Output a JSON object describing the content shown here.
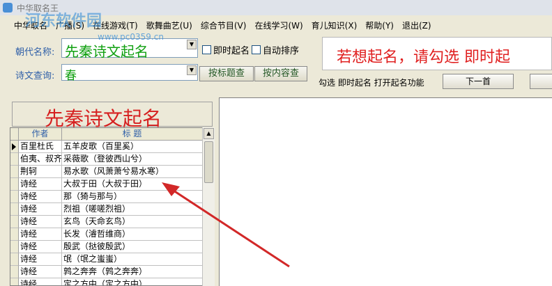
{
  "window": {
    "title": "中华取名王"
  },
  "watermark": {
    "text": "河东软件园",
    "url": "www.pc0359.cn"
  },
  "menu": {
    "items": [
      {
        "label": "中华取名"
      },
      {
        "label": "广播(S)"
      },
      {
        "label": "在线游戏(T)"
      },
      {
        "label": "歌舞曲艺(U)"
      },
      {
        "label": "综合节目(V)"
      },
      {
        "label": "在线学习(W)"
      },
      {
        "label": "育儿知识(X)"
      },
      {
        "label": "帮助(Y)"
      },
      {
        "label": "退出(Z)"
      }
    ]
  },
  "form": {
    "dynasty_label": "朝代名称:",
    "dynasty_value": "先秦诗文起名",
    "instant_checkbox_label": "即时起名",
    "autosort_checkbox_label": "自动排序",
    "query_label": "诗文查询:",
    "query_value": "春",
    "search_title_button": "按标题查",
    "search_content_button": "按内容查"
  },
  "banner": {
    "text": "若想起名，请勾选 即时起"
  },
  "hint": {
    "text": "勾选 即时起名 打开起名功能"
  },
  "next_button": {
    "label": "下一首"
  },
  "panel_title": {
    "text": "先秦诗文起名"
  },
  "table": {
    "columns": [
      "作者",
      "标 题"
    ],
    "rows": [
      [
        "百里杜氏",
        "五羊皮歌（百里奚）"
      ],
      [
        "伯夷、叔齐",
        "采薇歌（登彼西山兮）"
      ],
      [
        "荆轲",
        "易水歌（风萧萧兮易水寒）"
      ],
      [
        "诗经",
        "大叔于田（大叔于田）"
      ],
      [
        "诗经",
        "那（猗与那与）"
      ],
      [
        "诗经",
        "烈祖（嗟嗟烈祖）"
      ],
      [
        "诗经",
        "玄鸟（天命玄鸟）"
      ],
      [
        "诗经",
        "长发（濬哲维商）"
      ],
      [
        "诗经",
        "殷武（挞彼殷武）"
      ],
      [
        "诗经",
        "氓（氓之蚩蚩）"
      ],
      [
        "诗经",
        "鹑之奔奔（鹑之奔奔）"
      ],
      [
        "诗经",
        "定之方中（定之方中）"
      ]
    ]
  },
  "annotation": {
    "color": "#d22828"
  }
}
